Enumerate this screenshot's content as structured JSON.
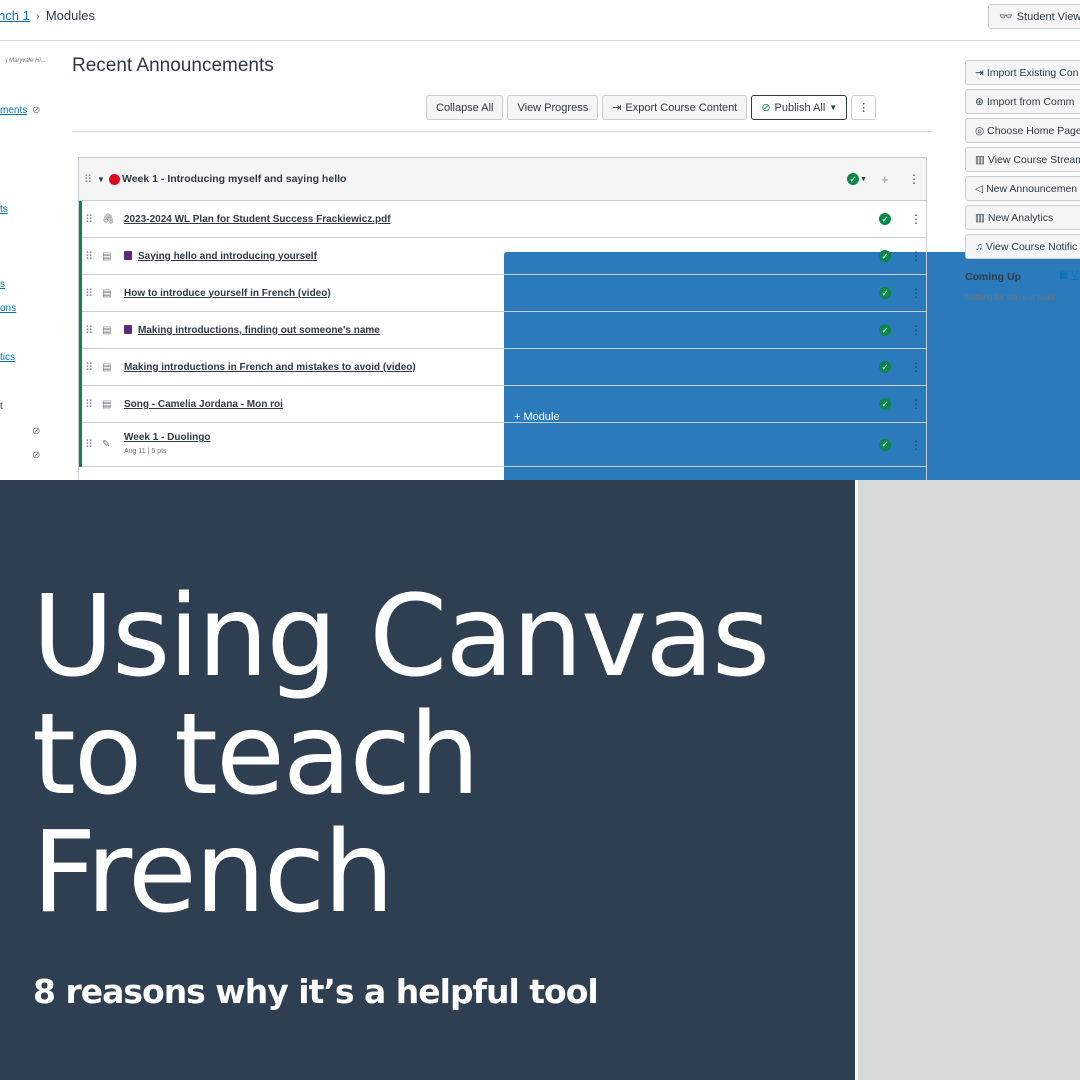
{
  "breadcrumb": {
    "course": "nch 1",
    "separator": "›",
    "current": "Modules"
  },
  "header": {
    "student_view": "Student View",
    "student_view_icon": "glasses-icon"
  },
  "leftnav": {
    "course_name": "j Maryvale Hi...",
    "links": [
      "ments",
      "ts",
      "s",
      "ons",
      "tics",
      "t"
    ]
  },
  "page": {
    "title": "Recent Announcements"
  },
  "toolbar": {
    "collapse_all": "Collapse All",
    "view_progress": "View Progress",
    "export": "Export Course Content",
    "publish_all": "Publish All",
    "add_module": "+ Module"
  },
  "module": {
    "title": "Week 1 - Introducing myself and saying hello",
    "status_color": "#e0061f",
    "items": [
      {
        "type": "attachment",
        "icon": "paperclip-icon",
        "title": "2023-2024 WL Plan for Student Success Frackiewicz.pdf",
        "book": false
      },
      {
        "type": "page",
        "icon": "page-icon",
        "title": "Saying hello and introducing yourself",
        "book": true
      },
      {
        "type": "page",
        "icon": "page-icon",
        "title": "How to introduce yourself in French (video)",
        "book": false
      },
      {
        "type": "page",
        "icon": "page-icon",
        "title": "Making introductions, finding out someone's name",
        "book": true
      },
      {
        "type": "page",
        "icon": "page-icon",
        "title": "Making introductions in French and mistakes to avoid (video)",
        "book": false
      },
      {
        "type": "page",
        "icon": "page-icon",
        "title": "Song - Camelia Jordana - Mon roi",
        "book": false
      },
      {
        "type": "assignment",
        "icon": "assignment-icon",
        "title": "Week 1 - Duolingo",
        "book": false,
        "meta": "Aug 11  |  5 pts"
      }
    ]
  },
  "sidebar": {
    "buttons": [
      {
        "icon": "import-icon",
        "label": "Import Existing Con"
      },
      {
        "icon": "commons-icon",
        "label": "Import from Comm"
      },
      {
        "icon": "home-page-icon",
        "label": "Choose Home Page"
      },
      {
        "icon": "stream-icon",
        "label": "View Course Stream"
      },
      {
        "icon": "megaphone-icon",
        "label": "New Announcemen"
      },
      {
        "icon": "analytics-icon",
        "label": "New Analytics"
      },
      {
        "icon": "bell-icon",
        "label": "View Course Notific"
      }
    ],
    "coming_up": "Coming Up",
    "coming_up_link": "V",
    "nothing": "Nothing for the next week"
  },
  "banner": {
    "headline_lines": [
      "Using Canvas",
      "to teach",
      "French"
    ],
    "tagline": "8 reasons why it’s a helpful tool",
    "bg_color": "#2d3f50",
    "panel_color": "#d5dad9"
  }
}
